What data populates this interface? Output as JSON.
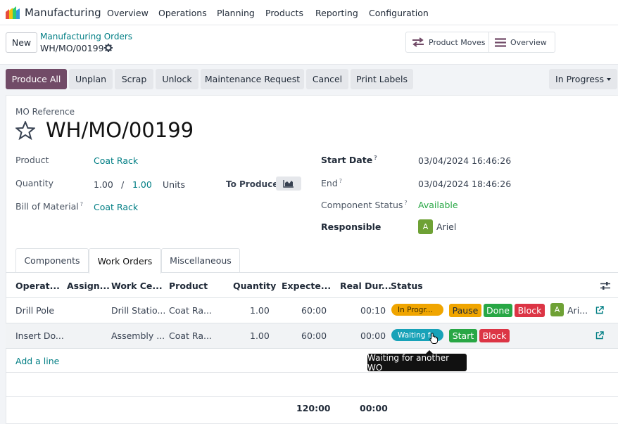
{
  "app": {
    "name": "Manufacturing"
  },
  "nav": {
    "items": [
      "Overview",
      "Operations",
      "Planning",
      "Products",
      "Reporting",
      "Configuration"
    ]
  },
  "control_panel": {
    "new_label": "New",
    "breadcrumb_parent": "Manufacturing Orders",
    "breadcrumb_current": "WH/MO/00199",
    "smart_buttons": {
      "product_moves": "Product Moves",
      "overview": "Overview"
    }
  },
  "statusbar": {
    "buttons": [
      "Produce All",
      "Unplan",
      "Scrap",
      "Unlock",
      "Maintenance Request",
      "Cancel",
      "Print Labels"
    ],
    "state": "In Progress"
  },
  "form": {
    "ref_label": "MO Reference",
    "ref_value": "WH/MO/00199",
    "product_label": "Product",
    "product_value": "Coat Rack",
    "quantity_label": "Quantity",
    "qty_done": "1.00",
    "qty_sep": "/",
    "qty_total": "1.00",
    "uom": "Units",
    "to_produce_label": "To Produce",
    "bom_label": "Bill of Material",
    "bom_value": "Coat Rack",
    "start_label": "Start Date",
    "start_value": "03/04/2024 16:46:26",
    "end_label": "End",
    "end_value": "03/04/2024 18:46:26",
    "component_status_label": "Component Status",
    "component_status_value": "Available",
    "responsible_label": "Responsible",
    "responsible_initial": "A",
    "responsible_value": "Ariel",
    "help_mark": "?"
  },
  "tabs": [
    "Components",
    "Work Orders",
    "Miscellaneous"
  ],
  "table": {
    "headers": [
      "Operat...",
      "Assign...",
      "Work Ce...",
      "Product",
      "Quantity",
      "Expecte...",
      "Real Dur...",
      "Status"
    ],
    "rows": [
      {
        "operation": "Drill Pole",
        "assigned": "",
        "work_center": "Drill Statio...",
        "product": "Coat Ra...",
        "quantity": "1.00",
        "expected": "60:00",
        "real": "00:10",
        "status": "In Progr...",
        "actions": [
          "Pause",
          "Done",
          "Block"
        ],
        "user_initial": "A",
        "user": "Ari..."
      },
      {
        "operation": "Insert Do...",
        "assigned": "",
        "work_center": "Assembly ...",
        "product": "Coat Ra...",
        "quantity": "1.00",
        "expected": "60:00",
        "real": "00:00",
        "status": "Waiting f...",
        "actions": [
          "Start",
          "Block"
        ]
      }
    ],
    "add_line": "Add a line",
    "total_expected": "120:00",
    "total_real": "00:00"
  },
  "tooltip": "Waiting for another WO",
  "colors": {
    "primary": "#714b67",
    "link": "#017e84",
    "pause": "#f0a500",
    "done": "#28a745",
    "block": "#dc3545",
    "waiting": "#17a2b8",
    "avatar": "#6ea135"
  }
}
